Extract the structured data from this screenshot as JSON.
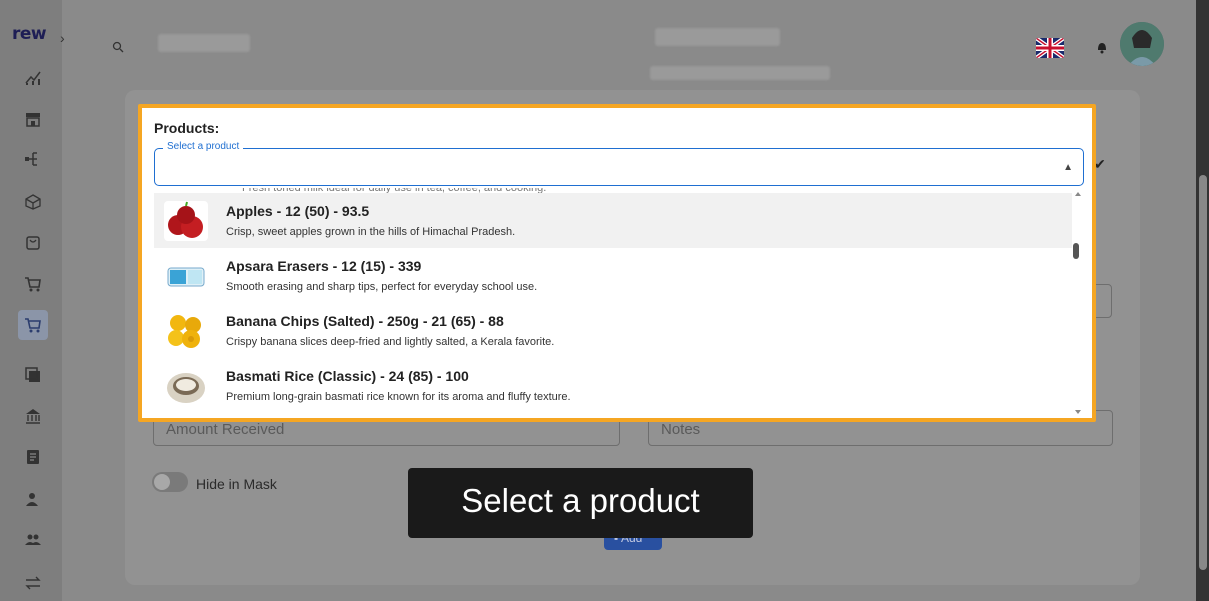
{
  "app": {
    "logo": "rew"
  },
  "sidebar": {
    "items": [
      {
        "icon": "analytics-icon"
      },
      {
        "icon": "store-icon"
      },
      {
        "icon": "hierarchy-icon"
      },
      {
        "icon": "box-icon"
      },
      {
        "icon": "bag-icon"
      },
      {
        "icon": "cart-icon"
      },
      {
        "icon": "cart-add-icon",
        "active": true
      },
      {
        "icon": "copy-icon"
      },
      {
        "icon": "bank-icon"
      },
      {
        "icon": "document-icon"
      },
      {
        "icon": "user-icon"
      },
      {
        "icon": "group-icon"
      },
      {
        "icon": "transfer-icon"
      }
    ]
  },
  "form": {
    "amount_received_placeholder": "Amount Received",
    "notes_placeholder": "Notes",
    "hide_in_mask_label": "Hide in Mask",
    "add_button_label": "Add"
  },
  "dialog": {
    "title": "Products:",
    "select_label": "Select a product",
    "options": [
      {
        "title": "Apples - 12 (50) - 93.5",
        "description": "Crisp, sweet apples grown in the hills of Himachal Pradesh.",
        "highlighted": true
      },
      {
        "title": "Apsara Erasers - 12 (15) - 339",
        "description": "Smooth erasing and sharp tips, perfect for everyday school use."
      },
      {
        "title": "Banana Chips (Salted) - 250g - 21 (65) - 88",
        "description": "Crispy banana slices deep-fried and lightly salted, a Kerala favorite."
      },
      {
        "title": "Basmati Rice (Classic) - 24 (85) - 100",
        "description": "Premium long-grain basmati rice known for its aroma and fluffy texture."
      }
    ]
  },
  "tooltip": {
    "text": "Select a product"
  },
  "colors": {
    "highlight_border": "#f5a623",
    "select_border": "#1f6fd1",
    "add_button": "#2950a0"
  }
}
